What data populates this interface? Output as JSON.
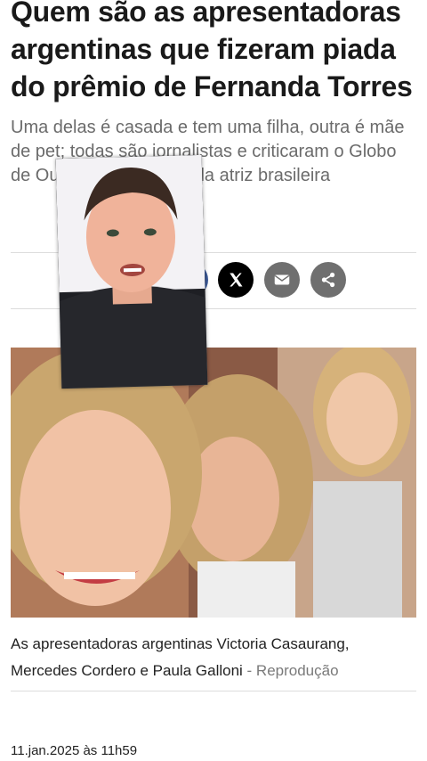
{
  "article": {
    "headline": "Quem são as apresentadoras argentinas que fizeram piada do prêmio de Fernanda Torres",
    "subhead": "Uma delas é casada e tem uma filha, outra é mãe de pet; todas são jornalistas e criticaram o Globo de Ouro conquistado pela atriz brasileira",
    "caption_text": "As apresentadoras argentinas Victoria Casaurang, Mercedes Cordero e Paula Galloni",
    "caption_separator": " - ",
    "caption_credit": "Reprodução",
    "date": "11.jan.2025 às 11h59"
  },
  "share": {
    "icons": [
      "whatsapp-icon",
      "facebook-icon",
      "x-icon",
      "mail-icon",
      "share-icon"
    ],
    "colors": {
      "x": "#000000",
      "mail": "#6f6f6f",
      "share": "#6f6f6f",
      "facebook": "#3b5998"
    }
  },
  "overlay": {
    "type": "picture-in-picture-video"
  }
}
